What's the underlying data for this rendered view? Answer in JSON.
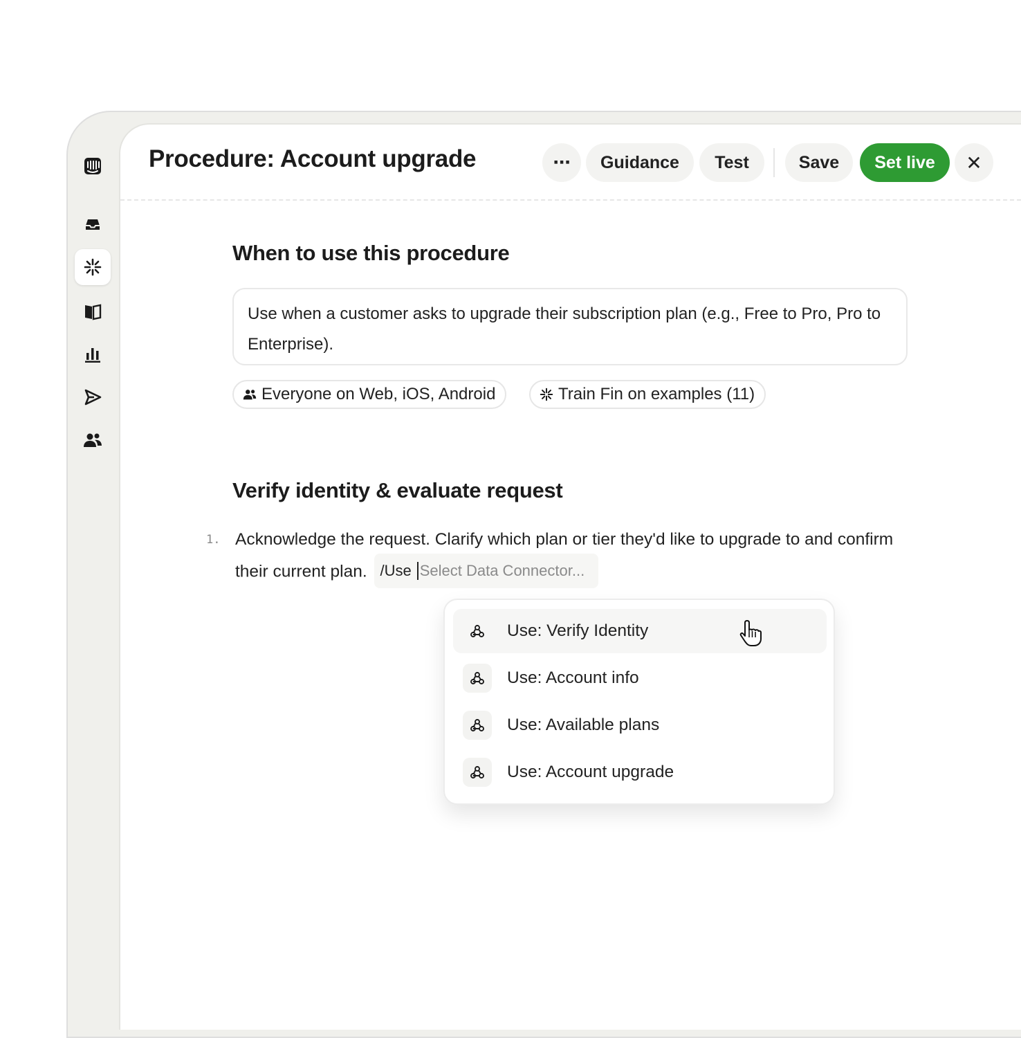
{
  "header": {
    "title": "Procedure: Account upgrade",
    "more_label": "⋯",
    "buttons": {
      "guidance": "Guidance",
      "test": "Test",
      "save": "Save",
      "set_live": "Set live",
      "close": "✕"
    }
  },
  "sidebar": {
    "items": [
      {
        "icon": "intercom-logo-icon",
        "active": false
      },
      {
        "icon": "inbox-icon",
        "active": false
      },
      {
        "icon": "fin-ai-icon",
        "active": true
      },
      {
        "icon": "knowledge-book-icon",
        "active": false
      },
      {
        "icon": "reports-bar-chart-icon",
        "active": false
      },
      {
        "icon": "outbound-send-icon",
        "active": false
      },
      {
        "icon": "contacts-people-icon",
        "active": false
      }
    ]
  },
  "when_section": {
    "heading": "When to use this procedure",
    "description": "Use when a customer asks to upgrade their subscription plan (e.g., Free to Pro, Pro to Enterprise).",
    "chips": {
      "audience": "Everyone on Web, iOS, Android",
      "train": "Train Fin on examples (11)"
    }
  },
  "steps_section": {
    "heading": "Verify identity & evaluate request",
    "steps": [
      {
        "number": "1.",
        "text": "Acknowledge the request. Clarify which plan or tier they'd like to upgrade to and confirm their current plan.",
        "slash_command": "/Use",
        "input_placeholder": "Select Data Connector..."
      }
    ]
  },
  "dropdown": {
    "items": [
      {
        "label": "Use: Verify Identity",
        "icon": "webhook-icon",
        "hovered": true
      },
      {
        "label": "Use: Account info",
        "icon": "webhook-icon",
        "hovered": false
      },
      {
        "label": "Use: Available plans",
        "icon": "webhook-icon",
        "hovered": false
      },
      {
        "label": "Use: Account upgrade",
        "icon": "webhook-icon",
        "hovered": false
      }
    ]
  },
  "colors": {
    "accent_green": "#2e9b33",
    "sidebar_bg": "#f0f0ec",
    "button_bg": "#f3f3f1"
  }
}
